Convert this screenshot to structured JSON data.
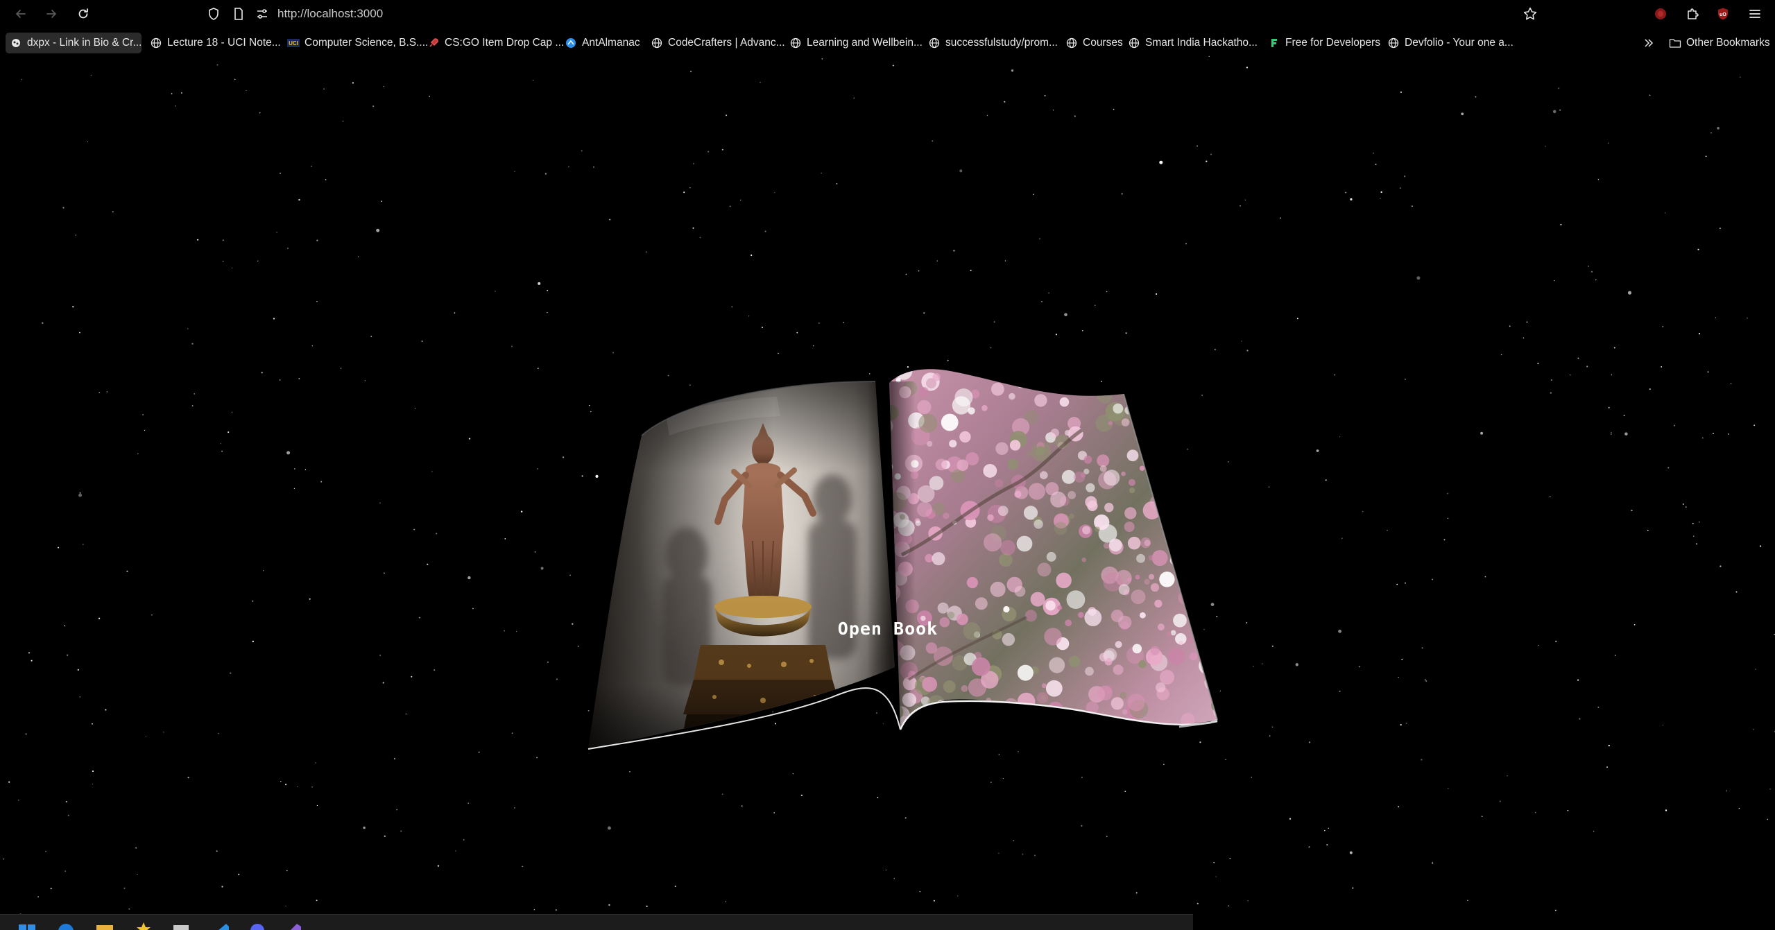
{
  "toolbar": {
    "url": "http://localhost:3000",
    "back_icon": "arrow-left-icon",
    "forward_icon": "arrow-right-icon",
    "reload_icon": "reload-icon"
  },
  "bookmarks": [
    {
      "label": "dxpx - Link in Bio & Cr...",
      "icon": "dxpx-favicon"
    },
    {
      "label": "Lecture 18 - UCI Note...",
      "icon": "globe-icon"
    },
    {
      "label": "Computer Science, B.S....",
      "icon": "uci-favicon"
    },
    {
      "label": "CS:GO Item Drop Cap ...",
      "icon": "rocket-favicon"
    },
    {
      "label": "AntAlmanac",
      "icon": "antalmanac-favicon"
    },
    {
      "label": "CodeCrafters | Advanc...",
      "icon": "globe-icon"
    },
    {
      "label": "Learning and Wellbein...",
      "icon": "globe-icon"
    },
    {
      "label": "successfulstudy/prom...",
      "icon": "globe-icon"
    },
    {
      "label": "Courses",
      "icon": "globe-icon"
    },
    {
      "label": "Smart India Hackatho...",
      "icon": "globe-icon"
    },
    {
      "label": "Free for Developers",
      "icon": "f-favicon"
    },
    {
      "label": "Devfolio - Your one a...",
      "icon": "globe-icon"
    }
  ],
  "other_bookmarks_label": "Other Bookmarks",
  "scene": {
    "button_label": "Open Book",
    "left_page_image": "wooden-bodhisattva-statue-photo",
    "right_page_image": "cherry-blossom-photo"
  },
  "colors": {
    "background": "#000000",
    "star": "#ffffff",
    "blossom_pink": "#e8a6c6"
  }
}
